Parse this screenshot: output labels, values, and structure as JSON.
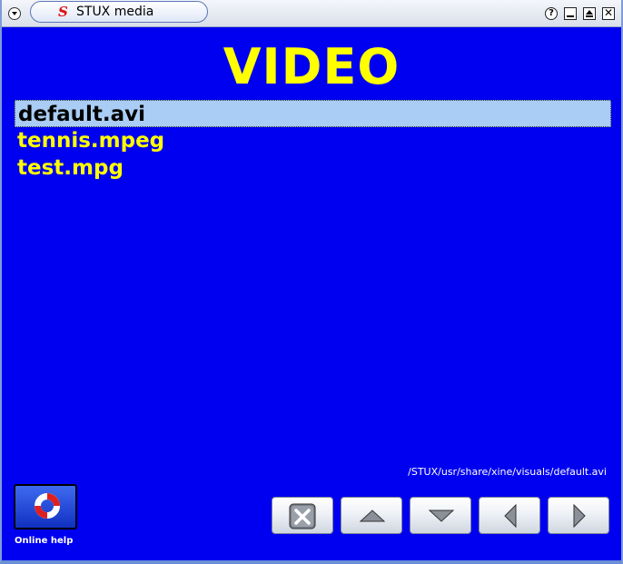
{
  "window": {
    "title": "STUX media",
    "logo_glyph": "S",
    "controls": {
      "help": "?",
      "close": "✕"
    }
  },
  "heading": "VIDEO",
  "files": [
    {
      "name": "default.avi",
      "selected": true
    },
    {
      "name": "tennis.mpeg",
      "selected": false
    },
    {
      "name": "test.mpg",
      "selected": false
    }
  ],
  "current_path": "/STUX/usr/share/xine/visuals/default.avi",
  "help": {
    "label": "Online help",
    "icon": "lifebuoy-icon"
  },
  "nav_buttons": [
    {
      "name": "close-button",
      "icon": "close-icon"
    },
    {
      "name": "up-button",
      "icon": "arrow-up-icon"
    },
    {
      "name": "down-button",
      "icon": "arrow-down-icon"
    },
    {
      "name": "left-button",
      "icon": "arrow-left-icon"
    },
    {
      "name": "right-button",
      "icon": "arrow-right-icon"
    }
  ],
  "colors": {
    "background": "#0000f0",
    "text": "#ffff00",
    "selection": "#a9cdf4"
  }
}
